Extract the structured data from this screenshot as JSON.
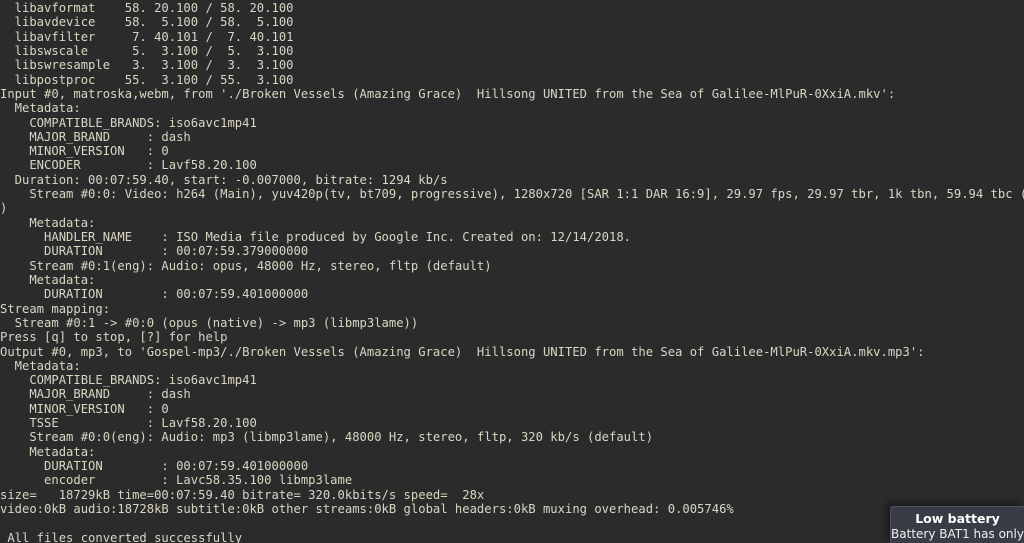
{
  "terminal": {
    "lines": [
      "  libavformat    58. 20.100 / 58. 20.100",
      "  libavdevice    58.  5.100 / 58.  5.100",
      "  libavfilter     7. 40.101 /  7. 40.101",
      "  libswscale      5.  3.100 /  5.  3.100",
      "  libswresample   3.  3.100 /  3.  3.100",
      "  libpostproc    55.  3.100 / 55.  3.100",
      "Input #0, matroska,webm, from './Broken Vessels (Amazing Grace)  Hillsong UNITED from the Sea of Galilee-MlPuR-0XxiA.mkv':",
      "  Metadata:",
      "    COMPATIBLE_BRANDS: iso6avc1mp41",
      "    MAJOR_BRAND     : dash",
      "    MINOR_VERSION   : 0",
      "    ENCODER         : Lavf58.20.100",
      "  Duration: 00:07:59.40, start: -0.007000, bitrate: 1294 kb/s",
      "    Stream #0:0: Video: h264 (Main), yuv420p(tv, bt709, progressive), 1280x720 [SAR 1:1 DAR 16:9], 29.97 fps, 29.97 tbr, 1k tbn, 59.94 tbc (default",
      ")",
      "    Metadata:",
      "      HANDLER_NAME    : ISO Media file produced by Google Inc. Created on: 12/14/2018.",
      "      DURATION        : 00:07:59.379000000",
      "    Stream #0:1(eng): Audio: opus, 48000 Hz, stereo, fltp (default)",
      "    Metadata:",
      "      DURATION        : 00:07:59.401000000",
      "Stream mapping:",
      "  Stream #0:1 -> #0:0 (opus (native) -> mp3 (libmp3lame))",
      "Press [q] to stop, [?] for help",
      "Output #0, mp3, to 'Gospel-mp3/./Broken Vessels (Amazing Grace)  Hillsong UNITED from the Sea of Galilee-MlPuR-0XxiA.mkv.mp3':",
      "  Metadata:",
      "    COMPATIBLE_BRANDS: iso6avc1mp41",
      "    MAJOR_BRAND     : dash",
      "    MINOR_VERSION   : 0",
      "    TSSE            : Lavf58.20.100",
      "    Stream #0:0(eng): Audio: mp3 (libmp3lame), 48000 Hz, stereo, fltp, 320 kb/s (default)",
      "    Metadata:",
      "      DURATION        : 00:07:59.401000000",
      "      encoder         : Lavc58.35.100 libmp3lame",
      "size=   18729kB time=00:07:59.40 bitrate= 320.0kbits/s speed=  28x",
      "video:0kB audio:18728kB subtitle:0kB other streams:0kB global headers:0kB muxing overhead: 0.005746%",
      "",
      " All files converted successfully"
    ],
    "colors": {
      "background": "#2b2b2b",
      "foreground": "#d9d6c4"
    }
  },
  "notification": {
    "title": "Low battery",
    "body": "Battery BAT1 has only",
    "colors": {
      "background": "#383c45",
      "border": "#4d525c",
      "text": "#ffffff"
    }
  }
}
